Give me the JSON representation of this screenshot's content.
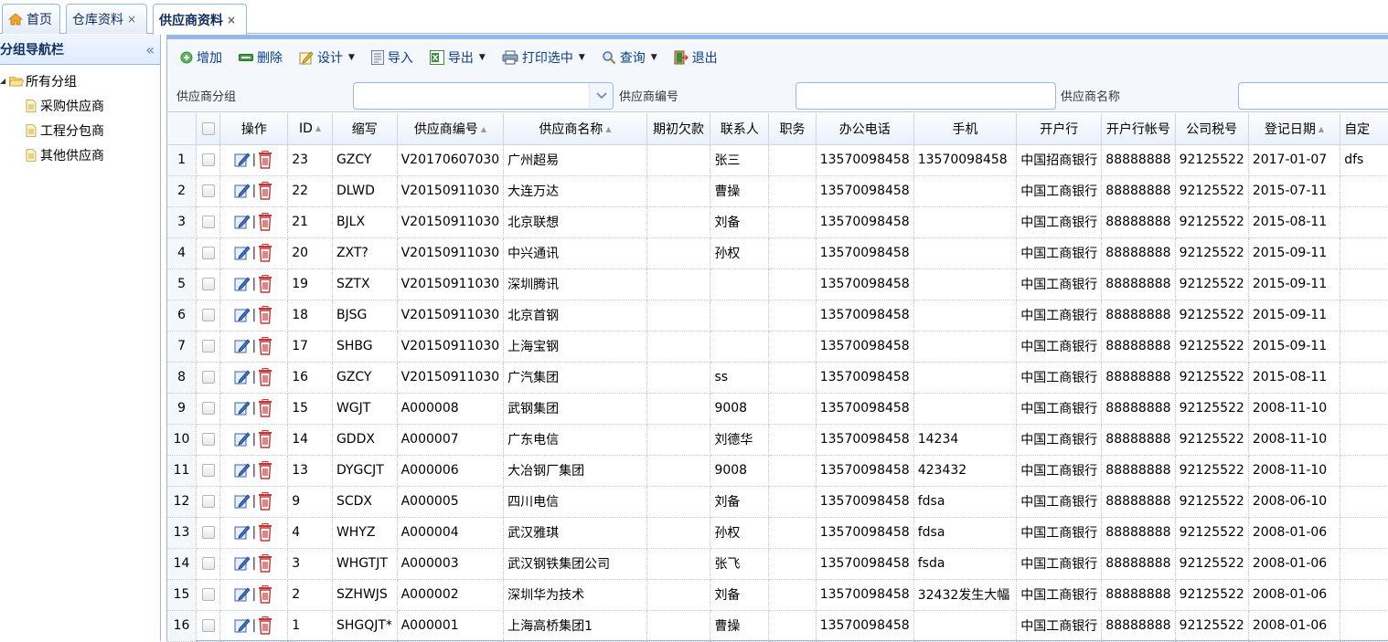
{
  "tabs": [
    {
      "label": "首页",
      "closable": false,
      "active": false
    },
    {
      "label": "仓库资料",
      "closable": true,
      "active": false
    },
    {
      "label": "供应商资料",
      "closable": true,
      "active": true
    }
  ],
  "close_glyph": "×",
  "nav": {
    "title": "分组导航栏",
    "collapse_glyph": "«",
    "root": "所有分组",
    "items": [
      "采购供应商",
      "工程分包商",
      "其他供应商"
    ]
  },
  "toolbar": {
    "add": "增加",
    "delete": "删除",
    "design": "设计",
    "import": "导入",
    "export": "导出",
    "print": "打印选中",
    "query": "查询",
    "exit": "退出"
  },
  "filters": {
    "group_label": "供应商分组",
    "group_value": "",
    "code_label": "供应商编号",
    "code_value": "",
    "name_label": "供应商名称",
    "name_value": ""
  },
  "grid": {
    "headers": {
      "ops": "操作",
      "id": "ID",
      "abbr": "缩写",
      "code": "供应商编号",
      "name": "供应商名称",
      "debt": "期初欠款",
      "contact": "联系人",
      "post": "职务",
      "office": "办公电话",
      "mobile": "手机",
      "bank": "开户行",
      "account": "开户行帐号",
      "tax": "公司税号",
      "date": "登记日期",
      "custom": "自定"
    },
    "rows": [
      {
        "n": "1",
        "id": "23",
        "abbr": "GZCY",
        "code": "V20170607030",
        "name": "广州超易",
        "debt": "",
        "contact": "张三",
        "post": "",
        "office": "13570098458",
        "mobile": "13570098458",
        "bank": "中国招商银行",
        "account": "88888888",
        "tax": "92125522",
        "date": "2017-01-07",
        "custom": "dfs"
      },
      {
        "n": "2",
        "id": "22",
        "abbr": "DLWD",
        "code": "V20150911030",
        "name": "大连万达",
        "debt": "",
        "contact": "曹操",
        "post": "",
        "office": "13570098458",
        "mobile": "",
        "bank": "中国工商银行",
        "account": "88888888",
        "tax": "92125522",
        "date": "2015-07-11",
        "custom": ""
      },
      {
        "n": "3",
        "id": "21",
        "abbr": "BJLX",
        "code": "V20150911030",
        "name": "北京联想",
        "debt": "",
        "contact": "刘备",
        "post": "",
        "office": "13570098458",
        "mobile": "",
        "bank": "中国工商银行",
        "account": "88888888",
        "tax": "92125522",
        "date": "2015-08-11",
        "custom": ""
      },
      {
        "n": "4",
        "id": "20",
        "abbr": "ZXT?",
        "code": "V20150911030",
        "name": "中兴通讯",
        "debt": "",
        "contact": "孙权",
        "post": "",
        "office": "13570098458",
        "mobile": "",
        "bank": "中国工商银行",
        "account": "88888888",
        "tax": "92125522",
        "date": "2015-09-11",
        "custom": ""
      },
      {
        "n": "5",
        "id": "19",
        "abbr": "SZTX",
        "code": "V20150911030",
        "name": "深圳腾讯",
        "debt": "",
        "contact": "",
        "post": "",
        "office": "13570098458",
        "mobile": "",
        "bank": "中国工商银行",
        "account": "88888888",
        "tax": "92125522",
        "date": "2015-09-11",
        "custom": ""
      },
      {
        "n": "6",
        "id": "18",
        "abbr": "BJSG",
        "code": "V20150911030",
        "name": "北京首钢",
        "debt": "",
        "contact": "",
        "post": "",
        "office": "13570098458",
        "mobile": "",
        "bank": "中国工商银行",
        "account": "88888888",
        "tax": "92125522",
        "date": "2015-09-11",
        "custom": ""
      },
      {
        "n": "7",
        "id": "17",
        "abbr": "SHBG",
        "code": "V20150911030",
        "name": "上海宝钢",
        "debt": "",
        "contact": "",
        "post": "",
        "office": "13570098458",
        "mobile": "",
        "bank": "中国工商银行",
        "account": "88888888",
        "tax": "92125522",
        "date": "2015-09-11",
        "custom": ""
      },
      {
        "n": "8",
        "id": "16",
        "abbr": "GZCY",
        "code": "V20150911030",
        "name": "广汽集团",
        "debt": "",
        "contact": "ss",
        "post": "",
        "office": "13570098458",
        "mobile": "",
        "bank": "中国工商银行",
        "account": "88888888",
        "tax": "92125522",
        "date": "2015-08-11",
        "custom": ""
      },
      {
        "n": "9",
        "id": "15",
        "abbr": "WGJT",
        "code": "A000008",
        "name": "武钢集团",
        "debt": "",
        "contact": "9008",
        "post": "",
        "office": "13570098458",
        "mobile": "",
        "bank": "中国工商银行",
        "account": "88888888",
        "tax": "92125522",
        "date": "2008-11-10",
        "custom": ""
      },
      {
        "n": "10",
        "id": "14",
        "abbr": "GDDX",
        "code": "A000007",
        "name": "广东电信",
        "debt": "",
        "contact": "刘德华",
        "post": "",
        "office": "13570098458",
        "mobile": "14234",
        "bank": "中国工商银行",
        "account": "88888888",
        "tax": "92125522",
        "date": "2008-11-10",
        "custom": ""
      },
      {
        "n": "11",
        "id": "13",
        "abbr": "DYGCJT",
        "code": "A000006",
        "name": "大冶钢厂集团",
        "debt": "",
        "contact": "9008",
        "post": "",
        "office": "13570098458",
        "mobile": "423432",
        "bank": "中国工商银行",
        "account": "88888888",
        "tax": "92125522",
        "date": "2008-11-10",
        "custom": ""
      },
      {
        "n": "12",
        "id": "9",
        "abbr": "SCDX",
        "code": "A000005",
        "name": "四川电信",
        "debt": "",
        "contact": "刘备",
        "post": "",
        "office": "13570098458",
        "mobile": "fdsa",
        "bank": "中国工商银行",
        "account": "88888888",
        "tax": "92125522",
        "date": "2008-06-10",
        "custom": ""
      },
      {
        "n": "13",
        "id": "4",
        "abbr": "WHYZ",
        "code": "A000004",
        "name": "武汉雅琪",
        "debt": "",
        "contact": "孙权",
        "post": "",
        "office": "13570098458",
        "mobile": "fdsa",
        "bank": "中国工商银行",
        "account": "88888888",
        "tax": "92125522",
        "date": "2008-01-06",
        "custom": ""
      },
      {
        "n": "14",
        "id": "3",
        "abbr": "WHGTJT",
        "code": "A000003",
        "name": "武汉钢铁集团公司",
        "debt": "",
        "contact": "张飞",
        "post": "",
        "office": "13570098458",
        "mobile": "fsda",
        "bank": "中国工商银行",
        "account": "88888888",
        "tax": "92125522",
        "date": "2008-01-06",
        "custom": ""
      },
      {
        "n": "15",
        "id": "2",
        "abbr": "SZHWJS",
        "code": "A000002",
        "name": "深圳华为技术",
        "debt": "",
        "contact": "刘备",
        "post": "",
        "office": "13570098458",
        "mobile": "32432发生大幅",
        "bank": "中国工商银行",
        "account": "88888888",
        "tax": "92125522",
        "date": "2008-01-06",
        "custom": ""
      },
      {
        "n": "16",
        "id": "1",
        "abbr": "SHGQJT*",
        "code": "A000001",
        "name": "上海高桥集团1",
        "debt": "",
        "contact": "曹操",
        "post": "",
        "office": "13570098458",
        "mobile": "",
        "bank": "中国工商银行",
        "account": "88888888",
        "tax": "92125522",
        "date": "2008-01-06",
        "custom": ""
      }
    ]
  }
}
